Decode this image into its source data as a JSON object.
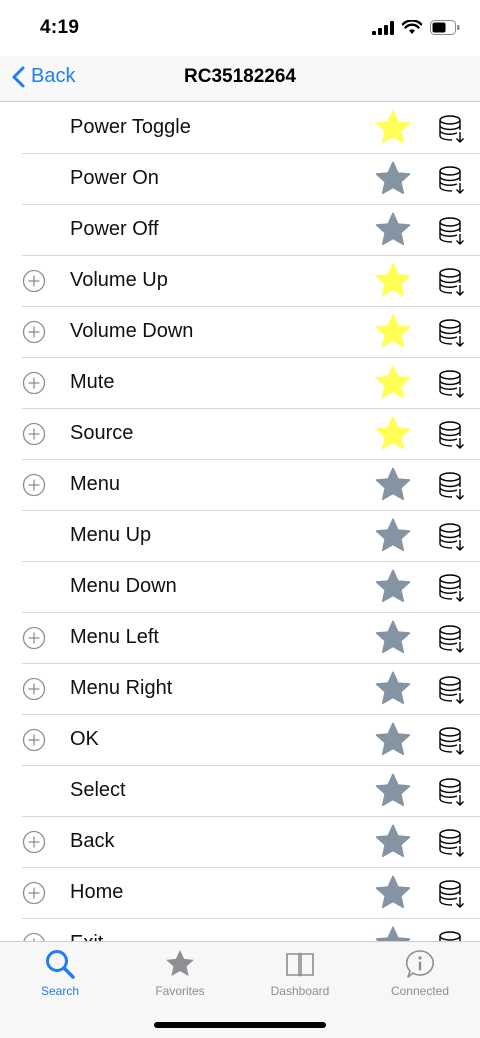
{
  "status": {
    "time": "4:19"
  },
  "nav": {
    "back_label": "Back",
    "title": "RC35182264"
  },
  "colors": {
    "accent": "#1e7ef5",
    "star_on": "#ffff55",
    "star_off": "#8594a3"
  },
  "commands": [
    {
      "label": "Power Toggle",
      "has_add": false,
      "favorite": true
    },
    {
      "label": "Power On",
      "has_add": false,
      "favorite": false
    },
    {
      "label": "Power Off",
      "has_add": false,
      "favorite": false
    },
    {
      "label": "Volume Up",
      "has_add": true,
      "favorite": true
    },
    {
      "label": "Volume Down",
      "has_add": true,
      "favorite": true
    },
    {
      "label": "Mute",
      "has_add": true,
      "favorite": true
    },
    {
      "label": "Source",
      "has_add": true,
      "favorite": true
    },
    {
      "label": "Menu",
      "has_add": true,
      "favorite": false
    },
    {
      "label": "Menu Up",
      "has_add": false,
      "favorite": false
    },
    {
      "label": "Menu Down",
      "has_add": false,
      "favorite": false
    },
    {
      "label": "Menu Left",
      "has_add": true,
      "favorite": false
    },
    {
      "label": "Menu Right",
      "has_add": true,
      "favorite": false
    },
    {
      "label": "OK",
      "has_add": true,
      "favorite": false
    },
    {
      "label": "Select",
      "has_add": false,
      "favorite": false
    },
    {
      "label": "Back",
      "has_add": true,
      "favorite": false
    },
    {
      "label": "Home",
      "has_add": true,
      "favorite": false
    },
    {
      "label": "Exit",
      "has_add": true,
      "favorite": false
    }
  ],
  "tabs": [
    {
      "label": "Search",
      "icon": "search-icon",
      "active": true
    },
    {
      "label": "Favorites",
      "icon": "star-icon",
      "active": false
    },
    {
      "label": "Dashboard",
      "icon": "book-icon",
      "active": false
    },
    {
      "label": "Connected",
      "icon": "info-bubble-icon",
      "active": false
    }
  ]
}
